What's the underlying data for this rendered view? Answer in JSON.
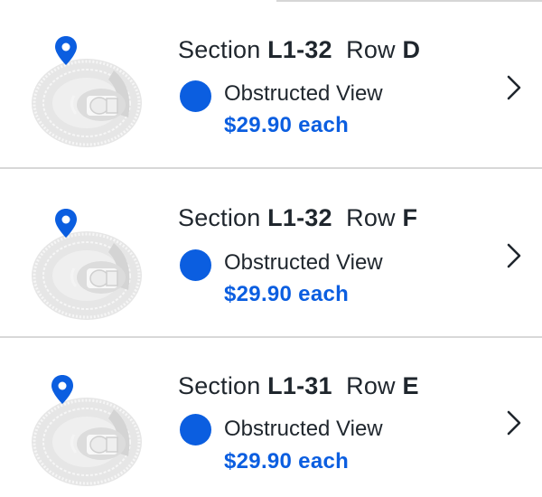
{
  "listings": [
    {
      "section_label": "Section",
      "section": "L1-32",
      "row_label": "Row",
      "row": "D",
      "feature": "Obstructed View",
      "price": "$29.90 each"
    },
    {
      "section_label": "Section",
      "section": "L1-32",
      "row_label": "Row",
      "row": "F",
      "feature": "Obstructed View",
      "price": "$29.90 each"
    },
    {
      "section_label": "Section",
      "section": "L1-31",
      "row_label": "Row",
      "row": "E",
      "feature": "Obstructed View",
      "price": "$29.90 each"
    }
  ],
  "colors": {
    "accent": "#0b5ee0",
    "text": "#1f262d",
    "divider": "#d8d8d8",
    "map": "#e6e6e6"
  },
  "icons": {
    "map": "venue-map-icon",
    "pin": "location-pin-icon",
    "feature_dot": "feature-dot-icon",
    "chevron": "chevron-right-icon"
  }
}
